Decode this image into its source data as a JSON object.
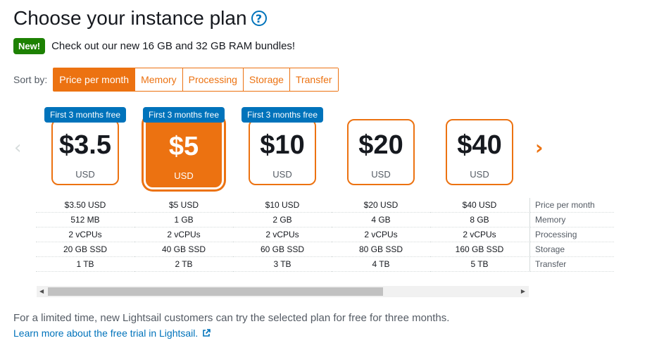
{
  "header": {
    "title": "Choose your instance plan",
    "help_icon": "?"
  },
  "announcement": {
    "badge": "New!",
    "text": "Check out our new 16 GB and 32 GB RAM bundles!"
  },
  "sort": {
    "label": "Sort by:",
    "options": [
      "Price per month",
      "Memory",
      "Processing",
      "Storage",
      "Transfer"
    ],
    "selected": "Price per month"
  },
  "plans": [
    {
      "promo": "First 3 months free",
      "price": "$3.5",
      "currency": "USD",
      "price_month": "$3.50 USD",
      "memory": "512 MB",
      "processing": "2 vCPUs",
      "storage": "20 GB SSD",
      "transfer": "1 TB"
    },
    {
      "promo": "First 3 months free",
      "price": "$5",
      "currency": "USD",
      "price_month": "$5 USD",
      "memory": "1 GB",
      "processing": "2 vCPUs",
      "storage": "40 GB SSD",
      "transfer": "2 TB"
    },
    {
      "promo": "First 3 months free",
      "price": "$10",
      "currency": "USD",
      "price_month": "$10 USD",
      "memory": "2 GB",
      "processing": "2 vCPUs",
      "storage": "60 GB SSD",
      "transfer": "3 TB"
    },
    {
      "promo": "",
      "price": "$20",
      "currency": "USD",
      "price_month": "$20 USD",
      "memory": "4 GB",
      "processing": "2 vCPUs",
      "storage": "80 GB SSD",
      "transfer": "4 TB"
    },
    {
      "promo": "",
      "price": "$40",
      "currency": "USD",
      "price_month": "$40 USD",
      "memory": "8 GB",
      "processing": "2 vCPUs",
      "storage": "160 GB SSD",
      "transfer": "5 TB"
    }
  ],
  "selected_plan_index": 1,
  "spec_labels": [
    "Price per month",
    "Memory",
    "Processing",
    "Storage",
    "Transfer"
  ],
  "nav": {
    "prev_icon": "chevron-left-icon",
    "next_icon": "chevron-right-icon",
    "prev_glyph": "‹",
    "next_glyph": "›"
  },
  "footer": {
    "text": "For a limited time, new Lightsail customers can try the selected plan for free for three months.",
    "link": "Learn more about the free trial in Lightsail."
  },
  "colors": {
    "accent": "#ec7211",
    "promo": "#0073bb",
    "new_badge": "#1d8102",
    "link": "#0073bb"
  }
}
